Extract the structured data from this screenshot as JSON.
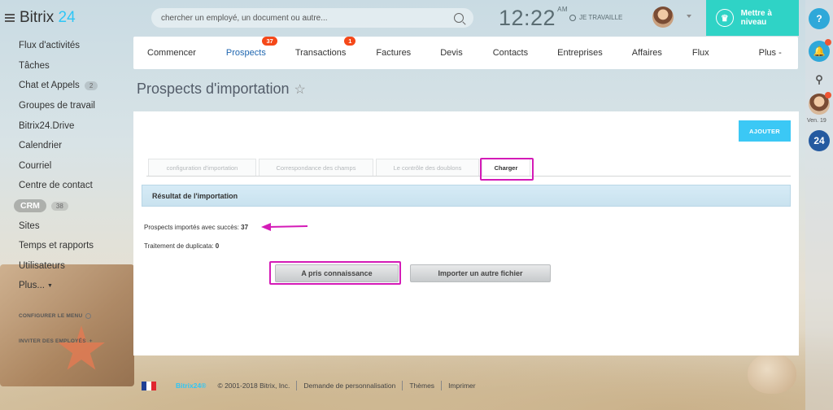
{
  "app": {
    "logo_text": "Bitrix",
    "logo_num": "24"
  },
  "search": {
    "placeholder": "chercher un employé, un document ou autre..."
  },
  "clock": {
    "time": "12:22",
    "ampm": "AM"
  },
  "work_status": "JE TRAVAILLE",
  "upgrade": {
    "label": "Mettre à niveau",
    "color": "#2fd3c6"
  },
  "sidebar": {
    "items": [
      {
        "label": "Flux d'activités"
      },
      {
        "label": "Tâches"
      },
      {
        "label": "Chat et Appels",
        "counter": "2"
      },
      {
        "label": "Groupes de travail"
      },
      {
        "label": "Bitrix24.Drive"
      },
      {
        "label": "Calendrier"
      },
      {
        "label": "Courriel"
      },
      {
        "label": "Centre de contact"
      },
      {
        "label": "CRM",
        "counter": "38"
      },
      {
        "label": "Sites"
      },
      {
        "label": "Temps et rapports"
      },
      {
        "label": "Utilisateurs"
      },
      {
        "label": "Plus..."
      }
    ],
    "configure": "CONFIGURER LE MENU",
    "invite": "INVITER DES EMPLOYÉS"
  },
  "tabs": [
    {
      "label": "Commencer"
    },
    {
      "label": "Prospects",
      "badge": "37",
      "active": true
    },
    {
      "label": "Transactions",
      "badge": "1"
    },
    {
      "label": "Factures"
    },
    {
      "label": "Devis"
    },
    {
      "label": "Contacts"
    },
    {
      "label": "Entreprises"
    },
    {
      "label": "Affaires"
    },
    {
      "label": "Flux"
    },
    {
      "label": "Plus -"
    }
  ],
  "page": {
    "title": "Prospects d'importation",
    "star": "☆"
  },
  "panel": {
    "add_button": "AJOUTER",
    "steps": [
      "configuration d'importation",
      "Correspondance des champs",
      "Le contrôle des doublons",
      "Charger"
    ],
    "result_header": "Résultat de l'importation",
    "imported_label": "Prospects importés avec succès:",
    "imported_value": "37",
    "duplicates_label": "Traitement de duplicata:",
    "duplicates_value": "0",
    "ack_button": "A pris connaissance",
    "import_other_button": "Importer un autre fichier"
  },
  "rail": {
    "date": "Ven. 19",
    "b24": "24",
    "help": "?"
  },
  "footer": {
    "brand": "Bitrix24®",
    "copyright": "© 2001-2018 Bitrix, Inc.",
    "links": [
      "Demande de personnalisation",
      "Thèmes",
      "Imprimer"
    ]
  },
  "colors": {
    "accent": "#2fc6f6",
    "highlight": "#d41bb7",
    "badge": "#f54819"
  }
}
